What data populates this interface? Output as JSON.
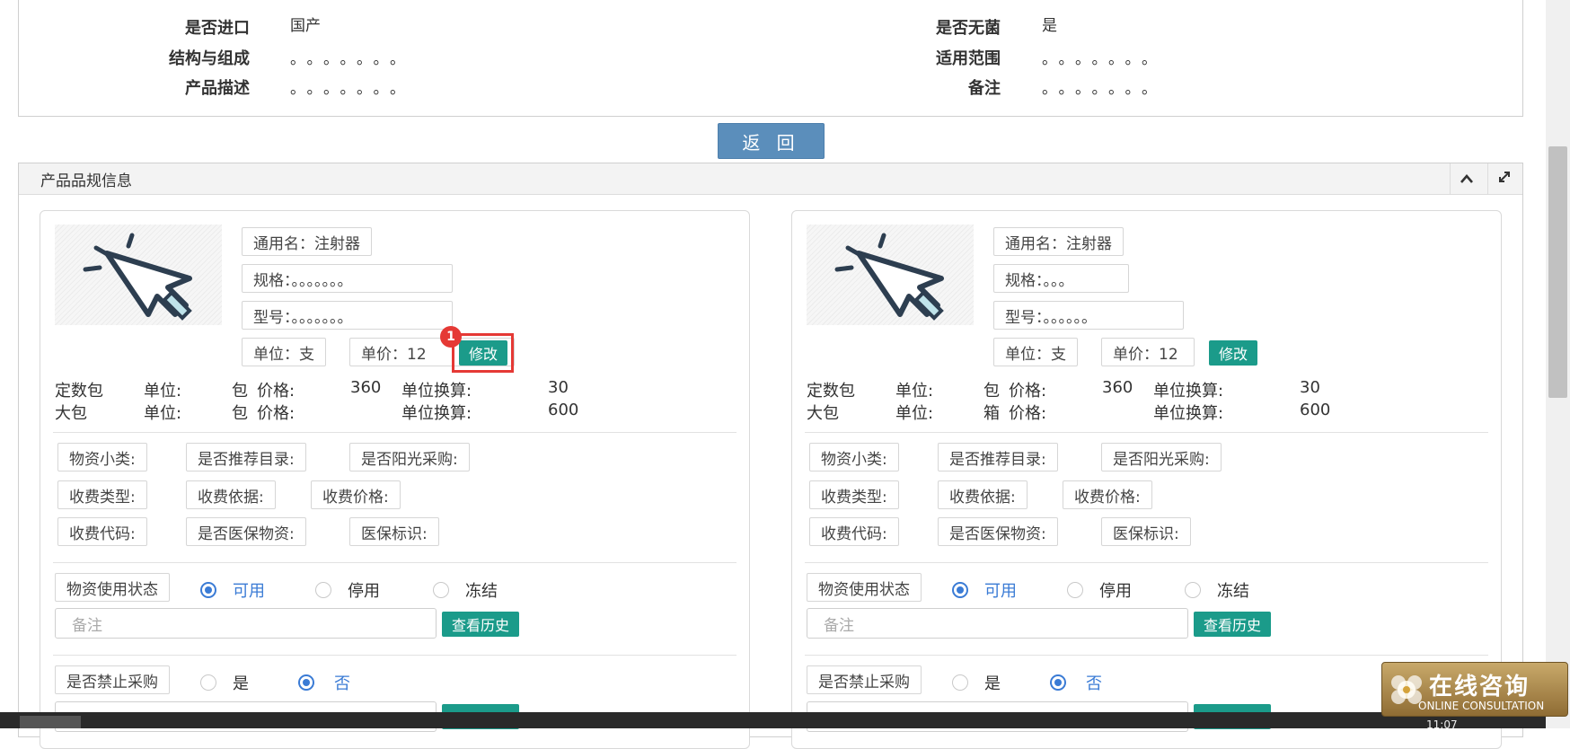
{
  "info": {
    "rows": [
      {
        "left_label": "是否进口",
        "left_value": "国产",
        "right_label": "是否无菌",
        "right_value": "是"
      },
      {
        "left_label": "结构与组成",
        "left_value": "。。。。。。。",
        "right_label": "适用范围",
        "right_value": "。。。。。。。"
      },
      {
        "left_label": "产品描述",
        "left_value": "。。。。。。。",
        "right_label": "备注",
        "right_value": "。。。。。。。"
      }
    ]
  },
  "back_button": "返 回",
  "section": {
    "title": "产品品规信息"
  },
  "cards": [
    {
      "generic_name": "通用名：注射器",
      "spec": "规格：。。。。。。。",
      "model": "型号：。。。。。。。",
      "unit": "单位：支",
      "price": "单价：12",
      "edit": "修改",
      "packs": [
        {
          "name": "定数包",
          "unit_label": "单位:",
          "unit": "包",
          "price_label": "价格:",
          "price": "360",
          "conv_label": "单位换算:",
          "conv": "30"
        },
        {
          "name": "大包",
          "unit_label": "单位:",
          "unit": "包",
          "price_label": "价格:",
          "price": "",
          "conv_label": "单位换算:",
          "conv": "600"
        }
      ]
    },
    {
      "generic_name": "通用名：注射器",
      "spec": "规格：。。。",
      "model": "型号：。。。。。。",
      "unit": "单位：支",
      "price": "单价：12",
      "edit": "修改",
      "packs": [
        {
          "name": "定数包",
          "unit_label": "单位:",
          "unit": "包",
          "price_label": "价格:",
          "price": "360",
          "conv_label": "单位换算:",
          "conv": "30"
        },
        {
          "name": "大包",
          "unit_label": "单位:",
          "unit": "箱",
          "price_label": "价格:",
          "price": "",
          "conv_label": "单位换算:",
          "conv": "600"
        }
      ]
    }
  ],
  "attr_tags": {
    "row1": [
      "物资小类:",
      "是否推荐目录:",
      "是否阳光采购:"
    ],
    "row2": [
      "收费类型:",
      "收费依据:",
      "收费价格:"
    ],
    "row3": [
      "收费代码:",
      "是否医保物资:",
      "医保标识:"
    ]
  },
  "status": {
    "label": "物资使用状态",
    "options": [
      "可用",
      "停用",
      "冻结"
    ],
    "selected": "可用",
    "remark_placeholder": "备注",
    "history_button": "查看历史"
  },
  "ban": {
    "label": "是否禁止采购",
    "options": [
      "是",
      "否"
    ],
    "selected": "否"
  },
  "annotation_badge": "1",
  "consult": {
    "title": "在线咨询",
    "subtitle": "ONLINE CONSULTATION"
  },
  "clock": "11:07",
  "colors": {
    "accent_green": "#1b9b8a",
    "back_blue": "#5b8ebb",
    "radio_blue": "#3a7bd5",
    "highlight_red": "#e53935"
  }
}
